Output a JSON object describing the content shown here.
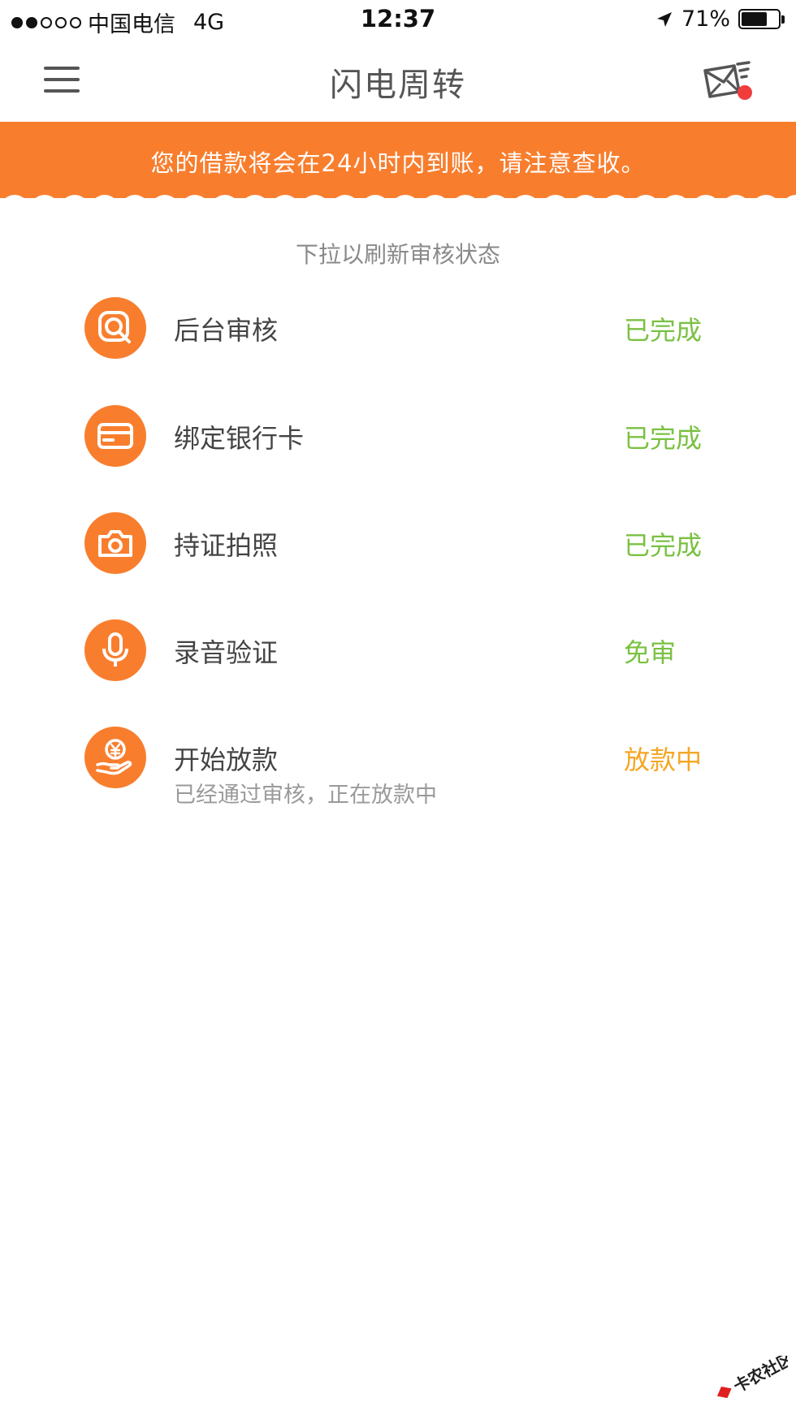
{
  "status_bar": {
    "carrier": "中国电信",
    "network": "4G",
    "time": "12:37",
    "battery": "71%",
    "battery_level": 0.71
  },
  "nav": {
    "title": "闪电周转",
    "menu_icon": "hamburger-menu-icon",
    "mail_icon": "mail-notification-icon"
  },
  "banner": {
    "text": "您的借款将会在24小时内到账，请注意查收。",
    "color": "#f87e2e"
  },
  "pull_hint": "下拉以刷新审核状态",
  "steps": [
    {
      "icon": "review-search-icon",
      "label": "后台审核",
      "status": "已完成"
    },
    {
      "icon": "bank-card-icon",
      "label": "绑定银行卡",
      "status": "已完成"
    },
    {
      "icon": "camera-icon",
      "label": "持证拍照",
      "status": "已完成"
    },
    {
      "icon": "microphone-icon",
      "label": "录音验证",
      "status": "免审"
    },
    {
      "icon": "yuan-hand-icon",
      "label": "开始放款",
      "status": "放款中",
      "sub": "已经通过审核，正在放款中"
    }
  ],
  "colors": {
    "accent": "#f87e2e",
    "done": "#7ac143",
    "paying": "#f5a623",
    "badge": "#f03c3c"
  }
}
